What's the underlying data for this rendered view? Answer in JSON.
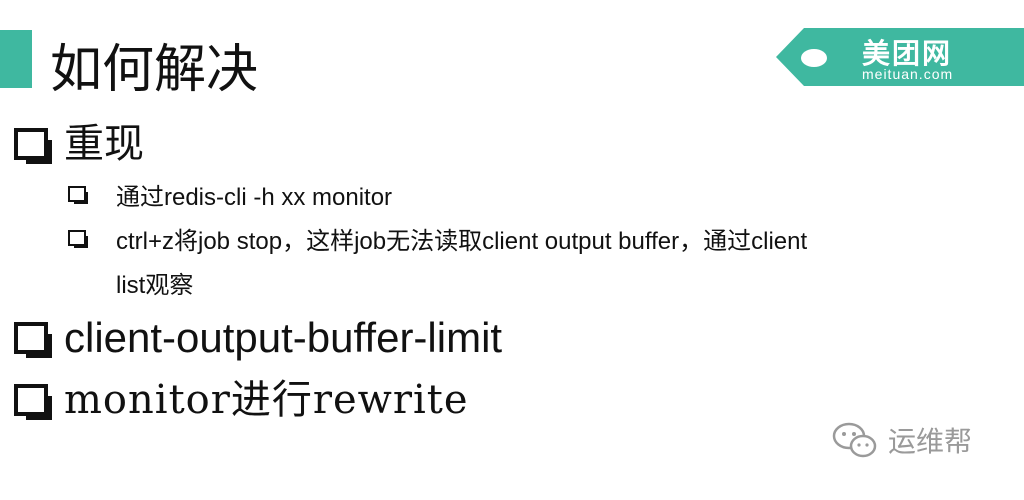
{
  "slide": {
    "title": "如何解决",
    "logo": {
      "main": "美团网",
      "sub": "meituan.com",
      "color": "#3fb8a0"
    },
    "items": [
      {
        "text": "重现",
        "subitems": [
          "通过redis-cli -h xx monitor",
          "ctrl+z将job stop，这样job无法读取client output buffer，通过client list观察"
        ]
      },
      {
        "text": "client-output-buffer-limit"
      },
      {
        "text": "monitor进行rewrite"
      }
    ],
    "watermark": {
      "text": "运维帮",
      "icon": "wechat-icon"
    }
  }
}
